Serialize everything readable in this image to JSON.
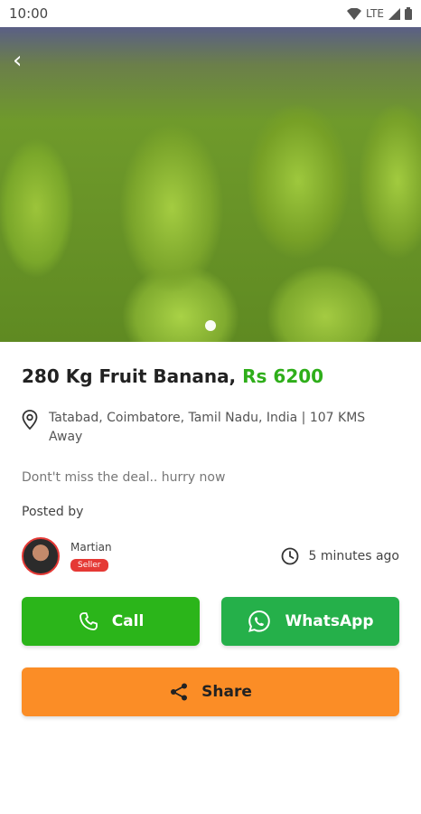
{
  "status": {
    "time": "10:00",
    "network": "LTE"
  },
  "listing": {
    "title": "280 Kg Fruit Banana,",
    "price": "Rs 6200",
    "location": "Tatabad, Coimbatore, Tamil Nadu, India | 107 KMS Away",
    "description": "Dont't miss the deal.. hurry now",
    "posted_by_label": "Posted by"
  },
  "seller": {
    "name": "Martian",
    "badge": "Seller",
    "time_ago": "5 minutes ago"
  },
  "actions": {
    "call": "Call",
    "whatsapp": "WhatsApp",
    "share": "Share"
  },
  "gallery": {
    "current": 1,
    "total": 1
  },
  "colors": {
    "price": "#2fae1a",
    "call": "#2bb51a",
    "whatsapp": "#25b04a",
    "share": "#fb8d26",
    "seller_badge": "#e53935"
  }
}
